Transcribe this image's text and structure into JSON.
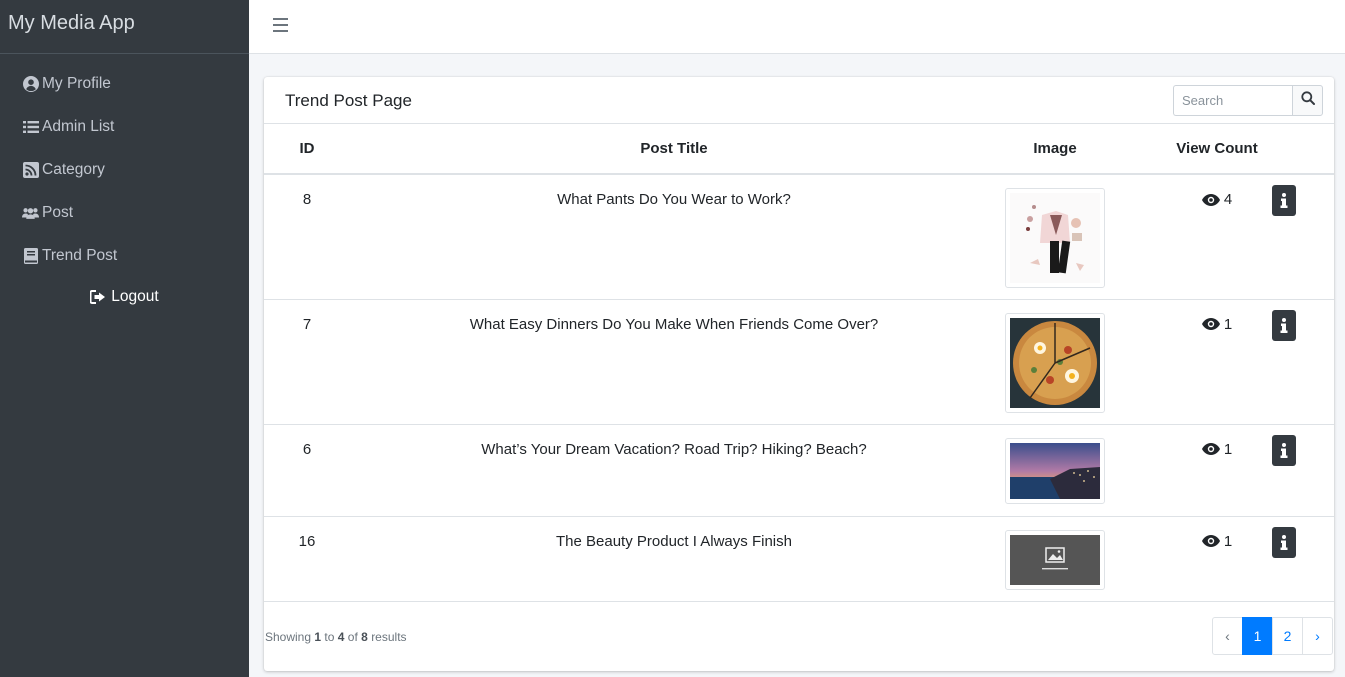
{
  "app": {
    "title": "My Media App"
  },
  "sidebar": {
    "items": [
      {
        "label": "My Profile",
        "icon": "user-circle-icon"
      },
      {
        "label": "Admin List",
        "icon": "list-icon"
      },
      {
        "label": "Category",
        "icon": "rss-icon"
      },
      {
        "label": "Post",
        "icon": "users-icon"
      },
      {
        "label": "Trend Post",
        "icon": "book-icon"
      }
    ],
    "logout_label": "Logout"
  },
  "card": {
    "title": "Trend Post Page",
    "search_placeholder": "Search"
  },
  "table": {
    "headers": [
      "ID",
      "Post Title",
      "Image",
      "View Count"
    ],
    "rows": [
      {
        "id": "8",
        "title": "What Pants Do You Wear to Work?",
        "image": "outfit-flatlay",
        "views": "4"
      },
      {
        "id": "7",
        "title": "What Easy Dinners Do You Make When Friends Come Over?",
        "image": "pizza",
        "views": "1"
      },
      {
        "id": "6",
        "title": "What’s Your Dream Vacation? Road Trip? Hiking? Beach?",
        "image": "coastal-sunset",
        "views": "1"
      },
      {
        "id": "16",
        "title": "The Beauty Product I Always Finish",
        "image": "placeholder-image",
        "views": "1"
      }
    ]
  },
  "footer": {
    "showing": "Showing",
    "from": "1",
    "to_word": "to",
    "to": "4",
    "of_word": "of",
    "total": "8",
    "results_word": "results"
  },
  "pagination": {
    "prev": "‹",
    "pages": [
      "1",
      "2"
    ],
    "next": "›",
    "current": "1"
  },
  "colors": {
    "sidebar": "#343a40",
    "accent": "#007bff"
  }
}
